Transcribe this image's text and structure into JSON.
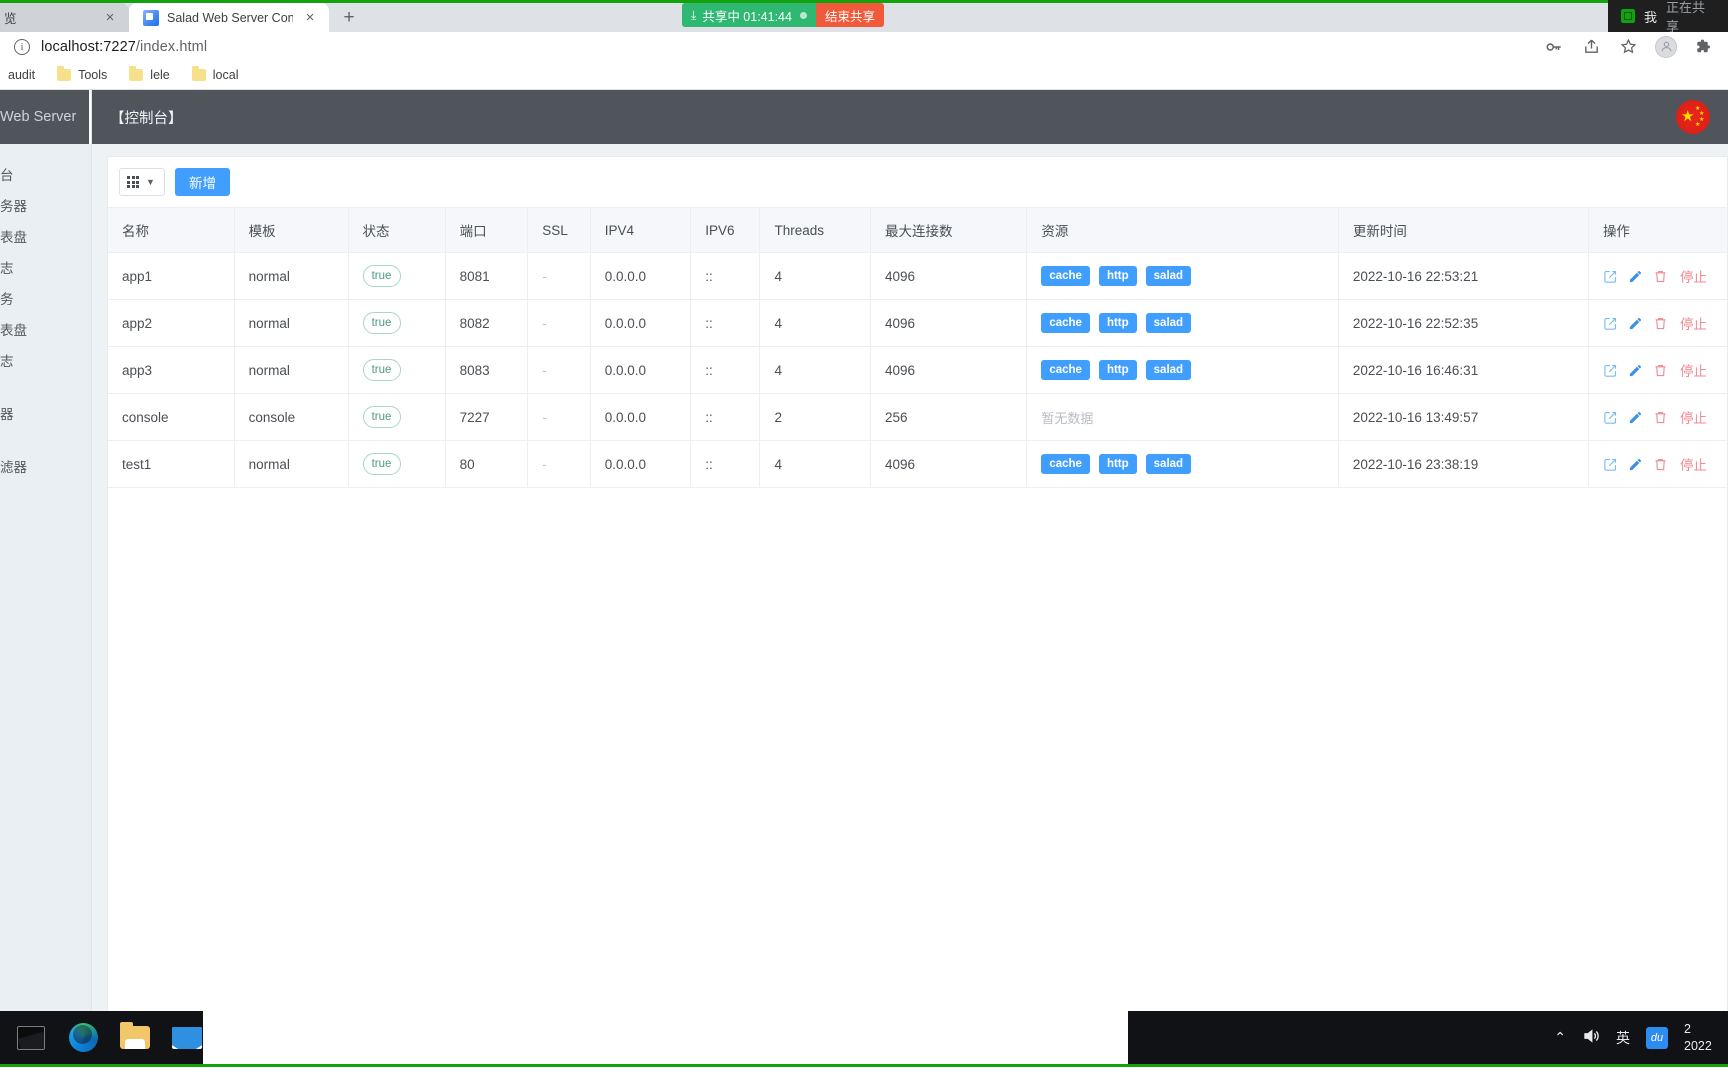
{
  "browser": {
    "tabs": [
      {
        "title": "览",
        "active": false,
        "close_label": "×"
      },
      {
        "title": "Salad Web Server Console",
        "active": true,
        "close_label": "×"
      }
    ],
    "new_tab_label": "+",
    "url_prefix": "localhost:7227",
    "url_suffix": "/index.html",
    "bookmarks": [
      "audit",
      "Tools",
      "lele",
      "local"
    ],
    "omni_icons": [
      "key-icon",
      "share-icon",
      "star-icon",
      "profile-icon",
      "extensions-icon"
    ]
  },
  "screenshare": {
    "status_text": "共享中 01:41:44",
    "stop_label": "结束共享",
    "badge_user": "我",
    "badge_status": "正在共享"
  },
  "sidebar": {
    "brand": "Web Server",
    "items": [
      {
        "label": "台"
      },
      {
        "label": "务器"
      },
      {
        "label": "表盘"
      },
      {
        "label": "志"
      },
      {
        "label": "务"
      },
      {
        "label": "表盘"
      },
      {
        "label": "志"
      },
      {
        "label": "器"
      },
      {
        "label": "滤器"
      }
    ]
  },
  "topbar": {
    "title": "【控制台】",
    "flag": "china-flag-icon"
  },
  "toolbar": {
    "column_selector_label": "",
    "add_label": "新增"
  },
  "table": {
    "headers": [
      "名称",
      "模板",
      "状态",
      "端口",
      "SSL",
      "IPV4",
      "IPV6",
      "Threads",
      "最大连接数",
      "资源",
      "更新时间",
      "操作"
    ],
    "no_data_text": "暂无数据",
    "stop_label": "停止",
    "rows": [
      {
        "name": "app1",
        "template": "normal",
        "status": "true",
        "port": "8081",
        "ssl": "-",
        "ipv4": "0.0.0.0",
        "ipv6": "::",
        "threads": "4",
        "max_conn": "4096",
        "resources": [
          "cache",
          "http",
          "salad"
        ],
        "updated": "2022-10-16 22:53:21"
      },
      {
        "name": "app2",
        "template": "normal",
        "status": "true",
        "port": "8082",
        "ssl": "-",
        "ipv4": "0.0.0.0",
        "ipv6": "::",
        "threads": "4",
        "max_conn": "4096",
        "resources": [
          "cache",
          "http",
          "salad"
        ],
        "updated": "2022-10-16 22:52:35"
      },
      {
        "name": "app3",
        "template": "normal",
        "status": "true",
        "port": "8083",
        "ssl": "-",
        "ipv4": "0.0.0.0",
        "ipv6": "::",
        "threads": "4",
        "max_conn": "4096",
        "resources": [
          "cache",
          "http",
          "salad"
        ],
        "updated": "2022-10-16 16:46:31"
      },
      {
        "name": "console",
        "template": "console",
        "status": "true",
        "port": "7227",
        "ssl": "-",
        "ipv4": "0.0.0.0",
        "ipv6": "::",
        "threads": "2",
        "max_conn": "256",
        "resources": [],
        "updated": "2022-10-16 13:49:57"
      },
      {
        "name": "test1",
        "template": "normal",
        "status": "true",
        "port": "80",
        "ssl": "-",
        "ipv4": "0.0.0.0",
        "ipv6": "::",
        "threads": "4",
        "max_conn": "4096",
        "resources": [
          "cache",
          "http",
          "salad"
        ],
        "updated": "2022-10-16 23:38:19"
      }
    ]
  },
  "taskbar": {
    "apps": [
      "terminal-icon",
      "edge-icon",
      "file-explorer-icon",
      "mail-icon"
    ],
    "tray": {
      "chevron": "⌃",
      "ime": "英",
      "du": "du",
      "time": "2",
      "date": "2022"
    }
  },
  "colors": {
    "accent": "#409eff",
    "share_green": "#2eb872",
    "share_stop": "#f0593a",
    "danger": "#f08a94",
    "header_bg": "#4f555b"
  }
}
